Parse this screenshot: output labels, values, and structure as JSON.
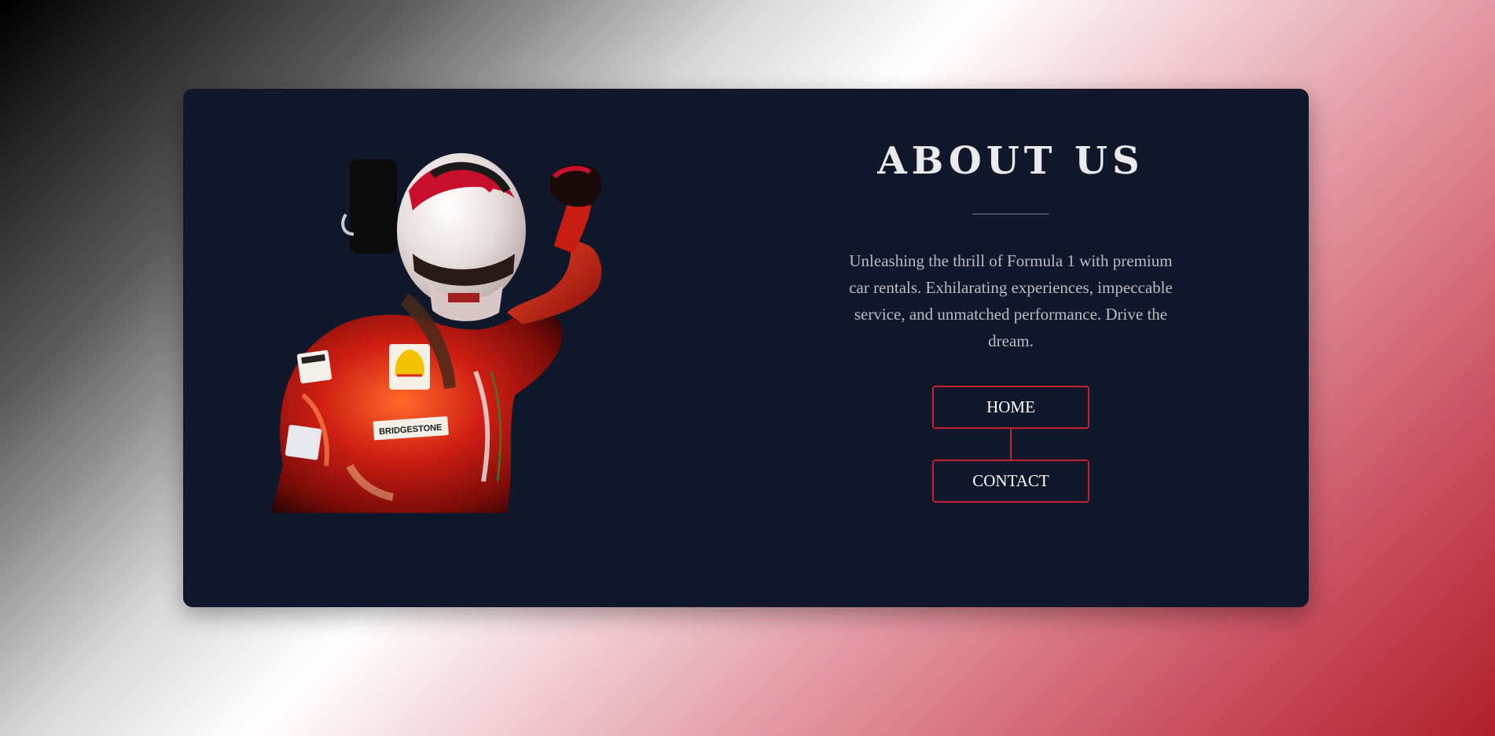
{
  "about": {
    "title": "ABOUT US",
    "description": "Unleashing the thrill of Formula 1 with premium car rentals. Exhilarating experiences, impeccable service, and unmatched performance. Drive the dream."
  },
  "nav": {
    "home_label": "HOME",
    "contact_label": "CONTACT"
  },
  "image": {
    "subject": "racing-driver-photo",
    "badge_text": "BRIDGESTONE"
  },
  "colors": {
    "card_background": "#11182b",
    "accent": "#c4202f",
    "title_text": "#e9eaee",
    "body_text": "#b9bcc6"
  }
}
